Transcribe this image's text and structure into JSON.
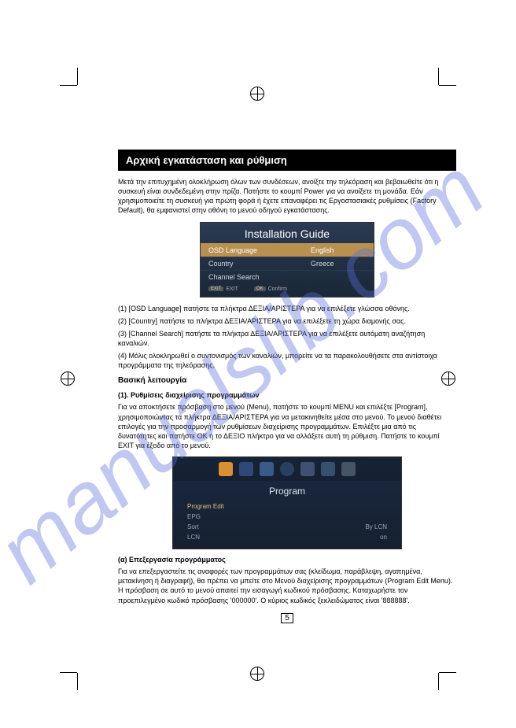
{
  "title": "Αρχική εγκατάσταση και ρύθμιση",
  "intro": "Μετά την επιτυχημένη ολοκλήρωση όλων των συνδέσεων, ανοίξτε την τηλεόραση και βεβαιωθείτε ότι η συσκευή είναι συνδεδεμένη στην πρίζα. Πατήστε το κουμπί Power για να ανοίξετε τη μονάδα. Εάν χρησιμοποιείτε τη συσκευή για πρώτη φορά ή έχετε επαναφέρει τις Εργοστασιακές ρυθμίσεις (Factory Default), θα εμφανιστεί στην οθόνη το μενού οδηγού εγκατάστασης.",
  "guide": {
    "title": "Installation Guide",
    "rows": [
      {
        "label": "OSD Language",
        "value": "English",
        "selected": true
      },
      {
        "label": "Country",
        "value": "Greece",
        "selected": false
      },
      {
        "label": "Channel Search",
        "value": "",
        "selected": false
      }
    ],
    "footer": {
      "exit_key": "EXIT",
      "exit_label": "EXIT",
      "ok_key": "OK",
      "ok_label": "Confirm"
    }
  },
  "steps": {
    "s1": "(1) [OSD Language] πατήστε τα πλήκτρα ΔΕΞΙΑ/ΑΡΙΣΤΕΡΑ για να επιλέξετε γλώσσα οθόνης.",
    "s2": "(2) [Country] πατήστε τα πλήκτρα ΔΕΞΙΑ/ΑΡΙΣΤΕΡΑ για να επιλέξετε τη χώρα διαμονής σας.",
    "s3": "(3) [Channel Search] πατήστε τα πλήκτρα ΔΕΞΙΑ/ΑΡΙΣΤΕΡΑ για να επιλέξετε αυτόματη αναζήτηση καναλιών.",
    "s4": "(4) Μόλις ολοκληρωθεί ο συντονισμός των καναλιών, μπορείτε να τα παρακολουθήσετε στα αντίστοιχα προγράμματα της τηλεόρασης."
  },
  "basic_title": "Βασική λειτουργία",
  "section1_title": "(1). Ρυθμίσεις διαχείρισης προγραμμάτων",
  "section1_body": "Για να αποκτήσετε πρόσβαση στο μενού (Menu), πατήστε το κουμπί MENU και επιλέξτε [Program], χρησιμοποιώντας τα πλήκτρα ΔΕΞΙΑ/ΑΡΙΣΤΕΡΑ για να μετακινηθείτε μέσα στο μενού. Το μενού διαθέτει επιλογές για την προσαρμογή των ρυθμίσεων διαχείρισης προγραμμάτων. Επιλέξτε μια από τις δυνατότητες και πατήστε OK ή το ΔΕΞΙΟ πλήκτρο για να αλλάξετε αυτή τη ρύθμιση. Πατήστε το κουμπί EXIT για έξοδο από το μενού.",
  "program": {
    "title": "Program",
    "rows": [
      {
        "label": "Program Edit",
        "value": "",
        "hl": true
      },
      {
        "label": "EPG",
        "value": "",
        "hl": false
      },
      {
        "label": "Sort",
        "value": "By LCN",
        "hl": false
      },
      {
        "label": "LCN",
        "value": "on",
        "hl": false
      }
    ]
  },
  "section_a_title": "(α) Επεξεργασία προγράμματος",
  "section_a_body": "Για να επεξεργαστείτε τις αναφορές των προγραμμάτων σας (κλείδωμα, παράβλεψη, αγαπημένα, μετακίνηση ή διαγραφή), θα πρέπει να μπείτε στο Μενού διαχείρισης προγραμμάτων (Program Edit Menu). Η πρόσβαση σε αυτό το μενού απαιτεί την εισαγωγή κωδικού πρόσβασης. Καταχωρήστε τον προεπιλεγμένο κωδικό πρόσβασης '000000'. Ο κύριος κωδικός ξεκλειδώματος είναι '888888'.",
  "page_number": "5",
  "watermark": "manualslib.com"
}
